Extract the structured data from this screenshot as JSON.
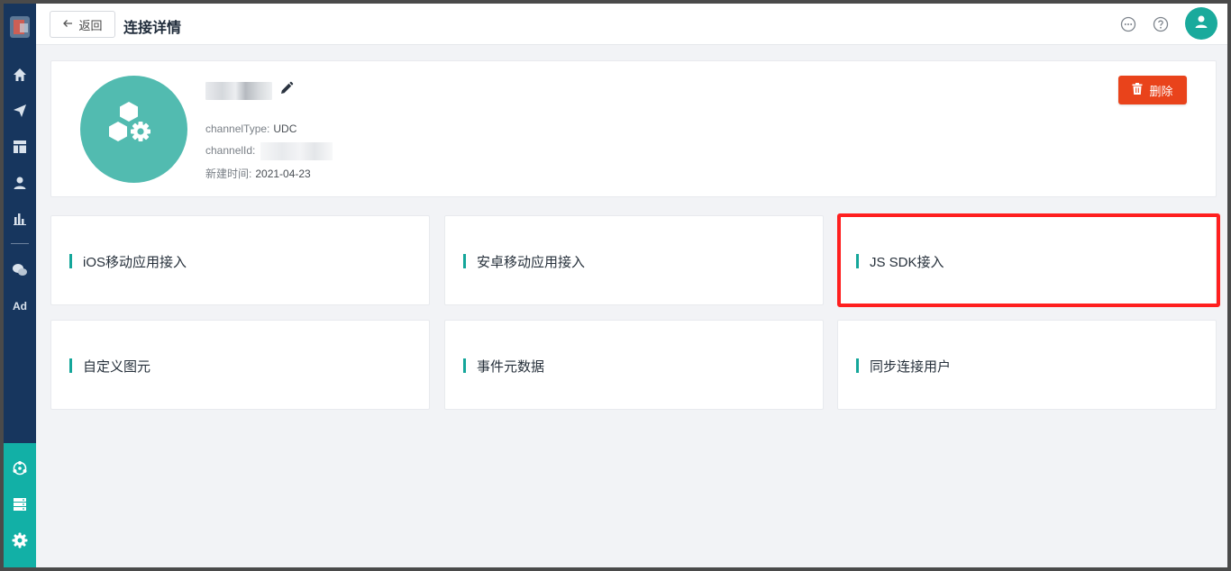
{
  "header": {
    "back_label": "返回",
    "title": "连接详情",
    "icons": [
      "chat-bubble-icon",
      "help-icon",
      "user-avatar-icon"
    ]
  },
  "sidebar": {
    "items": [
      "home-icon",
      "send-icon",
      "dashboard-icon",
      "user-icon",
      "bar-chart-icon",
      "wechat-icon",
      "ad-icon"
    ],
    "ad_label": "Ad",
    "bottom_items": [
      "network-icon",
      "server-icon",
      "settings-icon"
    ],
    "colors": {
      "background": "#17365e",
      "bottom": "#12b0a6"
    }
  },
  "info": {
    "channel_type_label": "channelType:",
    "channel_type_value": "UDC",
    "channel_id_label": "channelId:",
    "created_label": "新建时间:",
    "created_value": "2021-04-23",
    "delete_label": "删除"
  },
  "tiles": [
    {
      "label": "iOS移动应用接入"
    },
    {
      "label": "安卓移动应用接入"
    },
    {
      "label": "JS SDK接入",
      "highlighted": true
    },
    {
      "label": "自定义图元"
    },
    {
      "label": "事件元数据"
    },
    {
      "label": "同步连接用户"
    }
  ],
  "colors": {
    "accent": "#14a69a",
    "danger": "#e9431b",
    "highlight": "#ff1f1f"
  }
}
